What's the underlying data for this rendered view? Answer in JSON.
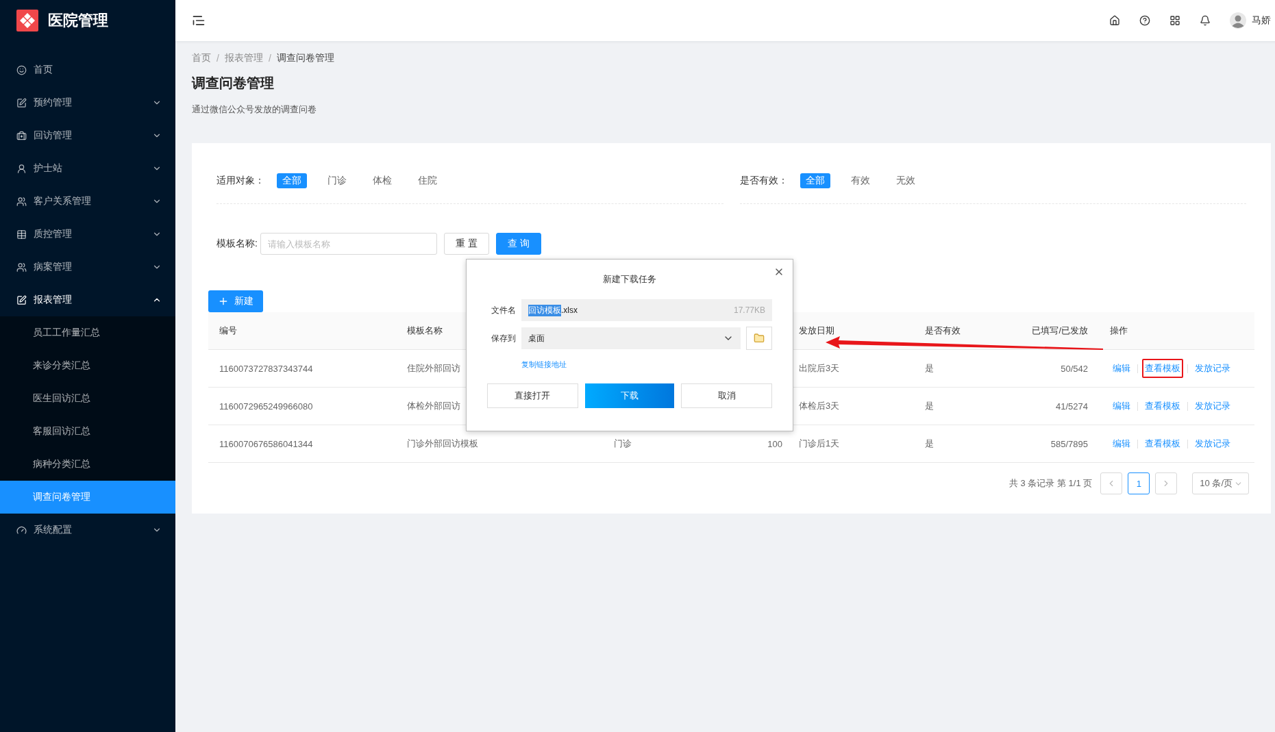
{
  "brand": {
    "title": "医院管理"
  },
  "sidebar": {
    "items": [
      {
        "label": "首页"
      },
      {
        "label": "预约管理",
        "expanded": false
      },
      {
        "label": "回访管理",
        "expanded": false
      },
      {
        "label": "护士站",
        "expanded": false
      },
      {
        "label": "客户关系管理",
        "expanded": false
      },
      {
        "label": "质控管理",
        "expanded": false
      },
      {
        "label": "病案管理",
        "expanded": false
      },
      {
        "label": "报表管理",
        "expanded": true,
        "children": [
          {
            "label": "员工工作量汇总",
            "selected": false
          },
          {
            "label": "来诊分类汇总",
            "selected": false
          },
          {
            "label": "医生回访汇总",
            "selected": false
          },
          {
            "label": "客服回访汇总",
            "selected": false
          },
          {
            "label": "病种分类汇总",
            "selected": false
          },
          {
            "label": "调查问卷管理",
            "selected": true
          }
        ]
      },
      {
        "label": "系统配置",
        "expanded": false
      }
    ]
  },
  "header": {
    "user_name": "马娇"
  },
  "breadcrumb": [
    "首页",
    "报表管理",
    "调查问卷管理"
  ],
  "breadcrumb_separator": "/",
  "page": {
    "title": "调查问卷管理",
    "description": "通过微信公众号发放的调查问卷"
  },
  "filters": [
    {
      "label": "适用对象：",
      "options": [
        {
          "label": "全部",
          "selected": true
        },
        {
          "label": "门诊",
          "selected": false
        },
        {
          "label": "体检",
          "selected": false
        },
        {
          "label": "住院",
          "selected": false
        }
      ]
    },
    {
      "label": "是否有效：",
      "options": [
        {
          "label": "全部",
          "selected": true
        },
        {
          "label": "有效",
          "selected": false
        },
        {
          "label": "无效",
          "selected": false
        }
      ]
    }
  ],
  "search": {
    "label": "模板名称:",
    "placeholder": "请输入模板名称",
    "reset": "重 置",
    "query": "查 询"
  },
  "new_button": "新建",
  "table": {
    "columns": [
      "编号",
      "模板名称",
      "发放日期",
      "是否有效",
      "已填写/已发放",
      "操作"
    ],
    "rows": [
      {
        "id": "1160073727837343744",
        "template_name": "住院外部回访",
        "issue_date": "出院后3天",
        "valid": "是",
        "filled_sent": "50/542",
        "actions": [
          {
            "label": "编辑",
            "highlighted": false
          },
          {
            "label": "查看模板",
            "highlighted": true
          },
          {
            "label": "发放记录",
            "highlighted": false
          }
        ]
      },
      {
        "id": "1160072965249966080",
        "template_name": "体检外部回访",
        "issue_date": "体检后3天",
        "valid": "是",
        "filled_sent": "41/5274",
        "actions": [
          {
            "label": "编辑",
            "highlighted": false
          },
          {
            "label": "查看模板",
            "highlighted": false
          },
          {
            "label": "发放记录",
            "highlighted": false
          }
        ]
      },
      {
        "id": "1160070676586041344",
        "template_name": "门诊外部回访模板",
        "column_3": "门诊",
        "column_4": "100",
        "issue_date": "门诊后1天",
        "valid": "是",
        "filled_sent": "585/7895",
        "actions": [
          {
            "label": "编辑",
            "highlighted": false
          },
          {
            "label": "查看模板",
            "highlighted": false
          },
          {
            "label": "发放记录",
            "highlighted": false
          }
        ]
      }
    ]
  },
  "pagination": {
    "summary": "共 3 条记录 第 1/1 页",
    "pages": [
      {
        "label": "1",
        "selected": true
      }
    ],
    "page_size": "10 条/页"
  },
  "dialog": {
    "title": "新建下载任务",
    "file_label": "文件名",
    "file_selected_part": "回访模板",
    "file_rest": ".xlsx",
    "file_size": "17.77KB",
    "save_label": "保存到",
    "save_value": "桌面",
    "copy_link": "复制链接地址",
    "buttons": [
      {
        "label": "直接打开",
        "kind": "secondary"
      },
      {
        "label": "下载",
        "kind": "primary"
      },
      {
        "label": "取消",
        "kind": "secondary"
      }
    ]
  }
}
